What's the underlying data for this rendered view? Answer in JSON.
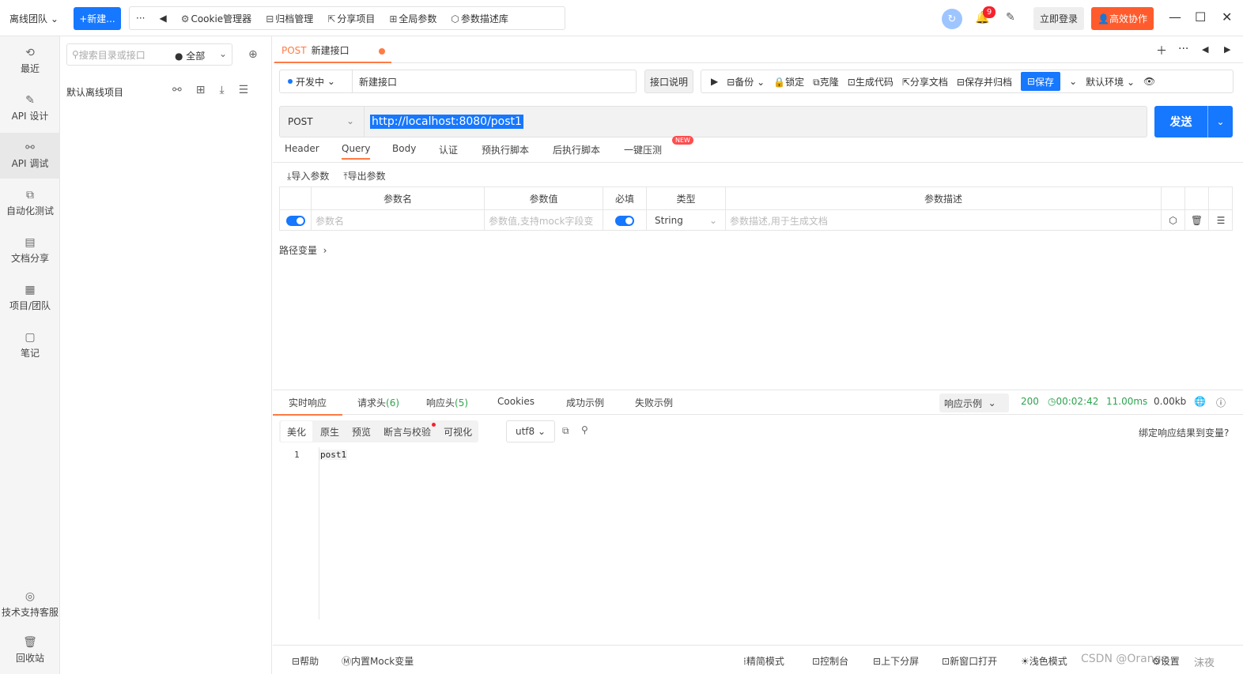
{
  "topbar": {
    "team": "离线团队",
    "new_button": "+新建...",
    "more": "···",
    "back": "◀",
    "tools": [
      {
        "icon": "cookie-icon",
        "label": "Cookie管理器"
      },
      {
        "icon": "archive-icon",
        "label": "归档管理"
      },
      {
        "icon": "share-icon",
        "label": "分享项目"
      },
      {
        "icon": "globe-param-icon",
        "label": "全局参数"
      },
      {
        "icon": "cube-icon",
        "label": "参数描述库"
      }
    ],
    "notify_count": "9",
    "login": "立即登录",
    "collab": "高效协作"
  },
  "sidebar": {
    "items": [
      {
        "label": "最近",
        "icon": "history-icon"
      },
      {
        "label": "API 设计",
        "icon": "edit-icon"
      },
      {
        "label": "API 调试",
        "icon": "link-icon"
      },
      {
        "label": "自动化测试",
        "icon": "flow-icon"
      },
      {
        "label": "文档分享",
        "icon": "doc-share-icon"
      },
      {
        "label": "项目/团队",
        "icon": "project-icon"
      },
      {
        "label": "笔记",
        "icon": "note-icon"
      }
    ],
    "support": "技术支持客服",
    "recycle": "回收站"
  },
  "tree": {
    "search_placeholder": "搜索目录或接口",
    "scope": "全部",
    "project": "默认离线项目"
  },
  "tab": {
    "method": "POST",
    "name": "新建接口"
  },
  "request": {
    "env_status": "开发中",
    "name": "新建接口",
    "doc_button": "接口说明",
    "actions": [
      "备份",
      "锁定",
      "克隆",
      "生成代码",
      "分享文档",
      "保存并归档"
    ],
    "save": "保存",
    "env": "默认环境",
    "method": "POST",
    "url": "http://localhost:8080/post1",
    "send": "发送"
  },
  "subtabs": [
    "Header",
    "Query",
    "Body",
    "认证",
    "预执行脚本",
    "后执行脚本",
    "一键压测"
  ],
  "subtabs_new_tag": "NEW",
  "params": {
    "import": "导入参数",
    "export": "导出参数",
    "headers": [
      "参数名",
      "参数值",
      "必填",
      "类型",
      "参数描述"
    ],
    "row": {
      "name_placeholder": "参数名",
      "value_placeholder": "参数值,支持mock字段变",
      "type": "String",
      "desc_placeholder": "参数描述,用于生成文档"
    },
    "path_vars": "路径变量"
  },
  "response": {
    "tabs": [
      "实时响应",
      "请求头(6)",
      "响应头(5)",
      "Cookies",
      "成功示例",
      "失败示例"
    ],
    "example": "响应示例",
    "status": "200",
    "time": "00:02:42",
    "duration": "11.00ms",
    "size": "0.00kb",
    "views": [
      "美化",
      "原生",
      "预览",
      "断言与校验",
      "可视化"
    ],
    "encoding": "utf8",
    "bind": "绑定响应结果到变量?",
    "line": "1",
    "body": "post1"
  },
  "bottom": [
    "帮助",
    "内置Mock变量",
    "精简模式",
    "控制台",
    "上下分屏",
    "新窗口打开",
    "浅色模式",
    "CSDN @Orange",
    "设置",
    "沫夜"
  ]
}
